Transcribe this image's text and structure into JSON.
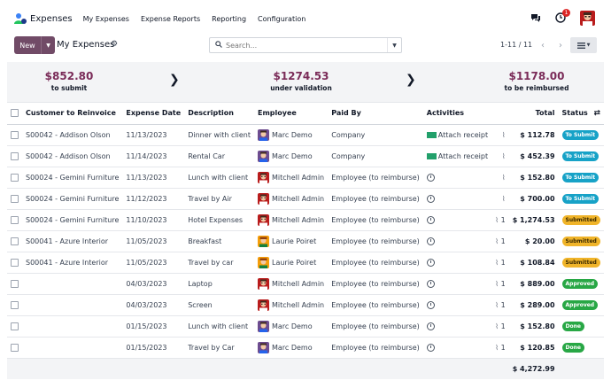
{
  "app": {
    "name": "Expenses"
  },
  "menu": [
    "My Expenses",
    "Expense Reports",
    "Reporting",
    "Configuration"
  ],
  "notifications": {
    "activity_count": "1"
  },
  "control": {
    "new_label": "New",
    "breadcrumb": "My Expenses",
    "search_placeholder": "Search...",
    "pager": "1-11 / 11"
  },
  "summary": [
    {
      "amount": "$852.80",
      "label": "to submit"
    },
    {
      "amount": "$1274.53",
      "label": "under validation"
    },
    {
      "amount": "$1178.00",
      "label": "to be reimbursed"
    }
  ],
  "columns": [
    "Customer to Reinvoice",
    "Expense Date",
    "Description",
    "Employee",
    "Paid By",
    "Activities",
    "Total",
    "Status"
  ],
  "rows": [
    {
      "customer": "S00042 - Addison Olson",
      "date": "11/13/2023",
      "description": "Dinner with client",
      "employee": "Marc Demo",
      "paid_by": "Company",
      "activity": "Attach receipt",
      "attachments": "",
      "total": "$ 112.78",
      "status": "To Submit",
      "status_kind": "submit",
      "avatar": "marc"
    },
    {
      "customer": "S00042 - Addison Olson",
      "date": "11/14/2023",
      "description": "Rental Car",
      "employee": "Marc Demo",
      "paid_by": "Company",
      "activity": "Attach receipt",
      "attachments": "",
      "total": "$ 452.39",
      "status": "To Submit",
      "status_kind": "submit",
      "avatar": "marc"
    },
    {
      "customer": "S00024 - Gemini Furniture",
      "date": "11/13/2023",
      "description": "Lunch with client",
      "employee": "Mitchell Admin",
      "paid_by": "Employee (to reimburse)",
      "activity": "",
      "attachments": "",
      "total": "$ 152.80",
      "status": "To Submit",
      "status_kind": "submit",
      "avatar": "mitchell"
    },
    {
      "customer": "S00024 - Gemini Furniture",
      "date": "11/12/2023",
      "description": "Travel by Air",
      "employee": "Mitchell Admin",
      "paid_by": "Employee (to reimburse)",
      "activity": "",
      "attachments": "",
      "total": "$ 700.00",
      "status": "To Submit",
      "status_kind": "submit",
      "avatar": "mitchell"
    },
    {
      "customer": "S00024 - Gemini Furniture",
      "date": "11/10/2023",
      "description": "Hotel Expenses",
      "employee": "Mitchell Admin",
      "paid_by": "Employee (to reimburse)",
      "activity": "",
      "attachments": "1",
      "total": "$ 1,274.53",
      "status": "Submitted",
      "status_kind": "submitted",
      "avatar": "mitchell"
    },
    {
      "customer": "S00041 - Azure Interior",
      "date": "11/05/2023",
      "description": "Breakfast",
      "employee": "Laurie Poiret",
      "paid_by": "Employee (to reimburse)",
      "activity": "",
      "attachments": "1",
      "total": "$ 20.00",
      "status": "Submitted",
      "status_kind": "submitted",
      "avatar": "laurie"
    },
    {
      "customer": "S00041 - Azure Interior",
      "date": "11/05/2023",
      "description": "Travel by car",
      "employee": "Laurie Poiret",
      "paid_by": "Employee (to reimburse)",
      "activity": "",
      "attachments": "1",
      "total": "$ 108.84",
      "status": "Submitted",
      "status_kind": "submitted",
      "avatar": "laurie"
    },
    {
      "customer": "",
      "date": "04/03/2023",
      "description": "Laptop",
      "employee": "Mitchell Admin",
      "paid_by": "Employee (to reimburse)",
      "activity": "",
      "attachments": "1",
      "total": "$ 889.00",
      "status": "Approved",
      "status_kind": "approved",
      "avatar": "mitchell"
    },
    {
      "customer": "",
      "date": "04/03/2023",
      "description": "Screen",
      "employee": "Mitchell Admin",
      "paid_by": "Employee (to reimburse)",
      "activity": "",
      "attachments": "1",
      "total": "$ 289.00",
      "status": "Approved",
      "status_kind": "approved",
      "avatar": "mitchell"
    },
    {
      "customer": "",
      "date": "01/15/2023",
      "description": "Lunch with client",
      "employee": "Marc Demo",
      "paid_by": "Employee (to reimburse)",
      "activity": "",
      "attachments": "1",
      "total": "$ 152.80",
      "status": "Done",
      "status_kind": "done",
      "avatar": "marc"
    },
    {
      "customer": "",
      "date": "01/15/2023",
      "description": "Travel by Car",
      "employee": "Marc Demo",
      "paid_by": "Employee (to reimburse)",
      "activity": "",
      "attachments": "1",
      "total": "$ 120.85",
      "status": "Done",
      "status_kind": "done",
      "avatar": "marc"
    }
  ],
  "grand_total": "$ 4,272.99"
}
